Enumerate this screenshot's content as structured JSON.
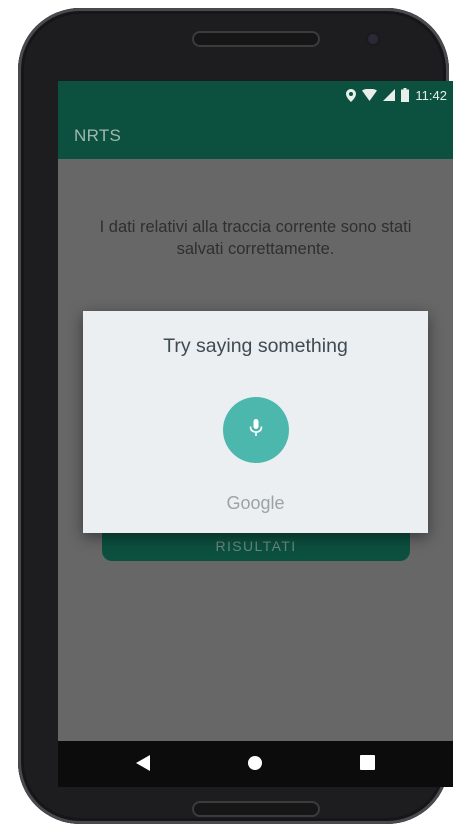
{
  "status_bar": {
    "time": "11:42",
    "icons": [
      "location-icon",
      "wifi-icon",
      "signal-icon",
      "battery-icon"
    ]
  },
  "app_bar": {
    "title": "NRTS"
  },
  "main": {
    "message": "I dati relativi alla traccia corrente sono stati salvati correttamente.",
    "results_button_label": "RISULTATI"
  },
  "voice_dialog": {
    "prompt": "Try saying something",
    "mic_icon": "mic-icon",
    "brand": "Google"
  },
  "nav_bar": {
    "buttons": [
      "back-icon",
      "home-icon",
      "recents-icon"
    ]
  },
  "colors": {
    "primary": "#0c5040",
    "accent": "#4cb7ad",
    "dialog_bg": "#eceff1",
    "scrim": "#676767"
  }
}
